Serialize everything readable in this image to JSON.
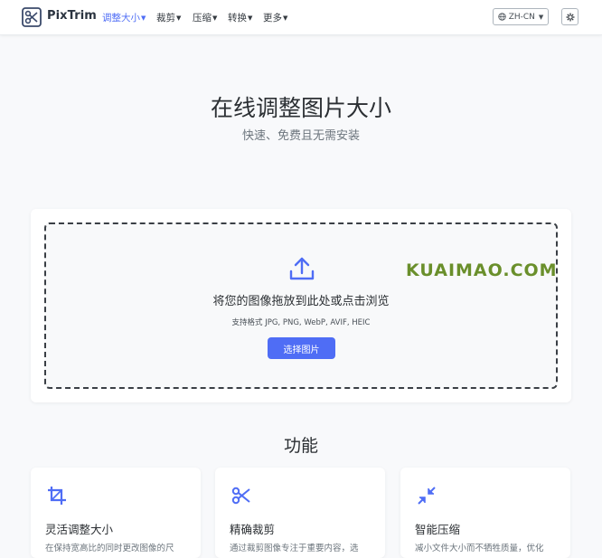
{
  "app": {
    "name": "PixTrim",
    "brand_color": "#4f6df5"
  },
  "nav": {
    "items": [
      {
        "label": "调整大小",
        "active": true
      },
      {
        "label": "裁剪",
        "active": false
      },
      {
        "label": "压缩",
        "active": false
      },
      {
        "label": "转换",
        "active": false
      },
      {
        "label": "更多",
        "active": false
      }
    ],
    "language": "ZH-CN",
    "icons": {
      "language": "globe-icon",
      "theme": "gear-icon",
      "dropdown": "caret-down-icon"
    }
  },
  "hero": {
    "title": "在线调整图片大小",
    "subtitle": "快速、免费且无需安装"
  },
  "upload": {
    "icon": "upload-icon",
    "instruction": "将您的图像拖放到此处或点击浏览",
    "formats": "支持格式 JPG, PNG, WebP, AVIF, HEIC",
    "button_label": "选择图片"
  },
  "watermark": "KUAIMAO.COM",
  "features": {
    "title": "功能",
    "cards": [
      {
        "icon": "crop-icon",
        "title": "灵活调整大小",
        "desc": "在保持宽高比的同时更改图像的尺"
      },
      {
        "icon": "scissors-icon",
        "title": "精确裁剪",
        "desc": "通过裁剪图像专注于重要内容，选"
      },
      {
        "icon": "compress-icon",
        "title": "智能压缩",
        "desc": "减小文件大小而不牺牲质量，优化"
      }
    ]
  }
}
